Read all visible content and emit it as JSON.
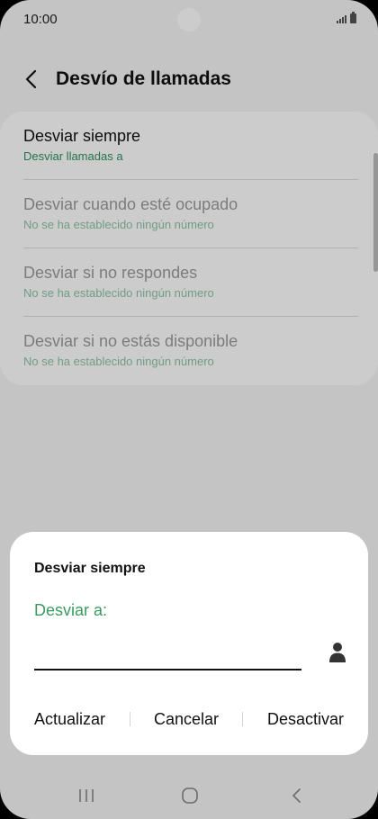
{
  "status_bar": {
    "time": "10:00"
  },
  "header": {
    "title": "Desvío de llamadas",
    "back_icon": "back-arrow-icon"
  },
  "settings": {
    "items": [
      {
        "title": "Desviar siempre",
        "subtitle": "Desviar llamadas a",
        "enabled": true
      },
      {
        "title": "Desviar cuando esté ocupado",
        "subtitle": "No se ha establecido ningún número",
        "enabled": false
      },
      {
        "title": "Desviar si no respondes",
        "subtitle": "No se ha establecido ningún número",
        "enabled": false
      },
      {
        "title": "Desviar si no estás disponible",
        "subtitle": "No se ha establecido ningún número",
        "enabled": false
      }
    ]
  },
  "dialog": {
    "title": "Desviar siempre",
    "label": "Desviar a:",
    "input_value": "",
    "contact_icon": "person-icon",
    "actions": {
      "update": "Actualizar",
      "cancel": "Cancelar",
      "deactivate": "Desactivar"
    }
  },
  "nav": {
    "recents_icon": "recent-apps-icon",
    "home_icon": "home-icon",
    "back_icon": "back-icon"
  },
  "colors": {
    "accent": "#3a9a5f",
    "subtitle_green": "#2f8f5e",
    "disabled_text": "#9c9c9c"
  }
}
